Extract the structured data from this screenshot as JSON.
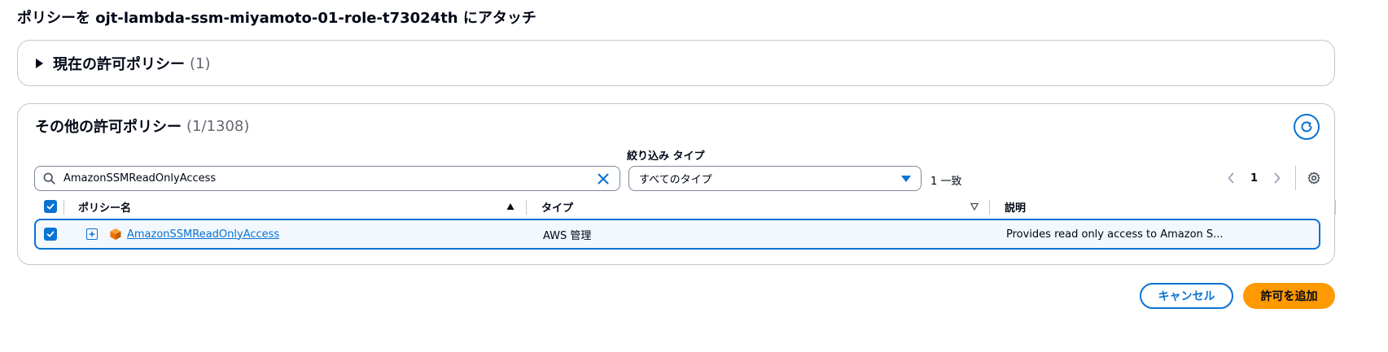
{
  "page": {
    "title": "ポリシーを ojt-lambda-ssm-miyamoto-01-role-t73024th にアタッチ"
  },
  "current_policies": {
    "heading": "現在の許可ポリシー",
    "count": "(1)"
  },
  "other_policies": {
    "heading": "その他の許可ポリシー",
    "count": "(1/1308)",
    "filter_type_label": "絞り込み タイプ",
    "search": {
      "value": "AmazonSSMReadOnlyAccess",
      "placeholder": "ポリシーを検索"
    },
    "type_select": {
      "selected": "すべてのタイプ"
    },
    "match_count": "1 一致",
    "pagination": {
      "current_page": "1"
    },
    "table": {
      "columns": [
        "ポリシー名",
        "タイプ",
        "説明"
      ],
      "rows": [
        {
          "name": "AmazonSSMReadOnlyAccess",
          "type": "AWS 管理",
          "description": "Provides read only access to Amazon S...",
          "selected": true
        }
      ]
    }
  },
  "actions": {
    "cancel_label": "キャンセル",
    "add_label": "許可を追加"
  },
  "colors": {
    "accent": "#0972d3",
    "primary_button": "#ff9900",
    "border": "#c6c6cd",
    "text": "#000716",
    "muted_text": "#656871",
    "aws_icon": "#ed7100"
  },
  "icons": {
    "expand": "caret-right-icon",
    "refresh": "refresh-icon",
    "search": "search-icon",
    "clear": "close-icon",
    "dropdown": "caret-down-icon",
    "prev": "chevron-left-icon",
    "next": "chevron-right-icon",
    "settings": "gear-icon",
    "sort_asc": "sort-ascending-icon",
    "sort": "sort-descending-icon",
    "checkbox": "checkbox-checked-icon",
    "expand_row": "plus-square-icon",
    "aws_managed": "aws-cube-icon"
  }
}
